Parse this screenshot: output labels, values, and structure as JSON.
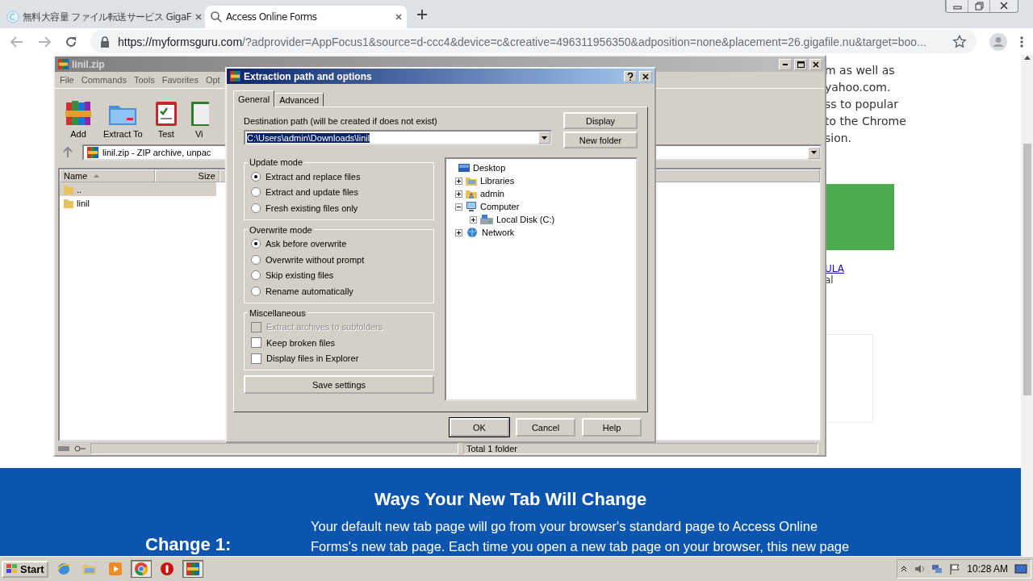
{
  "browser": {
    "tabs": [
      {
        "title": "無料大容量 ファイル転送サービス GigaF",
        "selected": false,
        "kind": "gigafile"
      },
      {
        "title": "Access Online Forms",
        "selected": true,
        "kind": "search"
      }
    ],
    "url_host": "https://myformsguru.com",
    "url_rest": "/?adprovider=AppFocus1&source=d-ccc4&device=c&creative=496311956350&adposition=none&placement=26.gigafile.nu&target=boo..."
  },
  "page": {
    "side_lines": [
      "m as well as",
      "yahoo.com.",
      "ss to popular",
      "to the Chrome",
      "sion."
    ],
    "link": "ULA",
    "after_link": "al",
    "band": {
      "heading": "Ways Your New Tab Will Change",
      "change_label": "Change 1:",
      "lines": [
        "Your default new tab page will go from your browser's standard page to Access Online",
        "Forms's new tab page. Each time you open a new tab page on your browser, this new page"
      ]
    }
  },
  "winrar": {
    "title": "linil.zip",
    "menu": [
      "File",
      "Commands",
      "Tools",
      "Favorites",
      "Opt"
    ],
    "toolbar": [
      {
        "label": "Add",
        "kind": "add"
      },
      {
        "label": "Extract To",
        "kind": "extract"
      },
      {
        "label": "Test",
        "kind": "test"
      },
      {
        "label": "Vi",
        "kind": "view"
      }
    ],
    "address": "linil.zip - ZIP archive, unpac",
    "columns": [
      "Name",
      "Size"
    ],
    "rows": [
      {
        "name": "..",
        "selected": true
      },
      {
        "name": "linil",
        "selected": false
      }
    ],
    "status": "Total 1 folder"
  },
  "dialog": {
    "title": "Extraction path and options",
    "tabs": [
      {
        "label": "General",
        "selected": true
      },
      {
        "label": "Advanced",
        "selected": false
      }
    ],
    "dest_label": "Destination path (will be created if does not exist)",
    "dest_value": "C:\\Users\\admin\\Downloads\\linil",
    "side_buttons": [
      "Display",
      "New folder"
    ],
    "groups": [
      {
        "title": "Update mode",
        "kind": "radio",
        "options": [
          {
            "label": "Extract and replace files",
            "selected": true
          },
          {
            "label": "Extract and update files",
            "selected": false
          },
          {
            "label": "Fresh existing files only",
            "selected": false
          }
        ]
      },
      {
        "title": "Overwrite mode",
        "kind": "radio",
        "options": [
          {
            "label": "Ask before overwrite",
            "selected": true
          },
          {
            "label": "Overwrite without prompt",
            "selected": false
          },
          {
            "label": "Skip existing files",
            "selected": false
          },
          {
            "label": "Rename automatically",
            "selected": false
          }
        ]
      },
      {
        "title": "Miscellaneous",
        "kind": "checkbox",
        "options": [
          {
            "label": "Extract archives to subfolders",
            "checked": false,
            "disabled": true
          },
          {
            "label": "Keep broken files",
            "checked": false,
            "disabled": false
          },
          {
            "label": "Display files in Explorer",
            "checked": false,
            "disabled": false
          }
        ]
      }
    ],
    "save_button": "Save settings",
    "tree": [
      {
        "label": "Desktop",
        "kind": "desktop",
        "children": [
          {
            "label": "Libraries",
            "kind": "libraries",
            "expanded": false
          },
          {
            "label": "admin",
            "kind": "user",
            "expanded": false
          },
          {
            "label": "Computer",
            "kind": "computer",
            "expanded": true,
            "children": [
              {
                "label": "Local Disk (C:)",
                "kind": "drive",
                "expanded": false
              }
            ]
          },
          {
            "label": "Network",
            "kind": "network",
            "expanded": false
          }
        ]
      }
    ],
    "buttons": [
      {
        "label": "OK",
        "default": true
      },
      {
        "label": "Cancel",
        "default": false
      },
      {
        "label": "Help",
        "default": false
      }
    ]
  },
  "taskbar": {
    "start": "Start",
    "apps": [
      {
        "kind": "ie",
        "active": false
      },
      {
        "kind": "explorer",
        "active": false
      },
      {
        "kind": "media",
        "active": false
      },
      {
        "kind": "chrome",
        "active": true
      },
      {
        "kind": "opera",
        "active": false
      },
      {
        "kind": "winrar",
        "active": true
      }
    ],
    "clock": "10:28 AM"
  }
}
